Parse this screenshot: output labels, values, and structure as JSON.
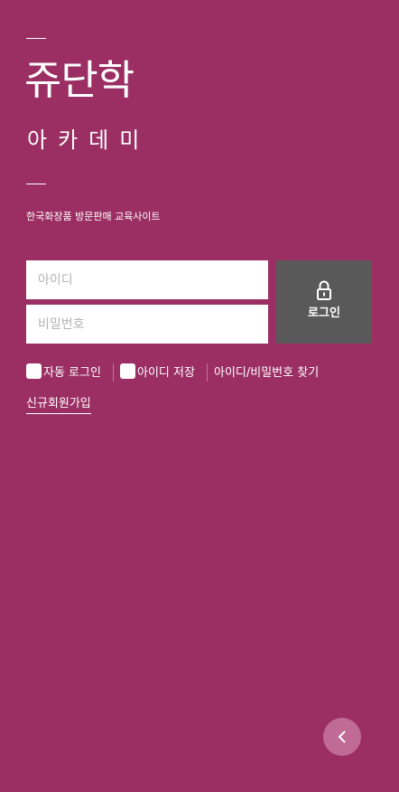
{
  "brand": {
    "title": "쥬단학",
    "subtitle": "아카데미",
    "tagline": "한국화장품 방문판매 교육사이트"
  },
  "login": {
    "id_placeholder": "아이디",
    "pw_placeholder": "비밀번호",
    "button_label": "로그인",
    "button_icon": "lock-icon"
  },
  "options": {
    "auto_login": "자동 로그인",
    "save_id": "아이디 저장",
    "find_account": "아이디/비밀번호 찾기"
  },
  "signup_label": "신규회원가입",
  "nav": {
    "back_icon": "chevron-left-icon"
  },
  "colors": {
    "background": "#9b2f63",
    "login_button": "#5a5959",
    "back_button": "#c06b96"
  }
}
